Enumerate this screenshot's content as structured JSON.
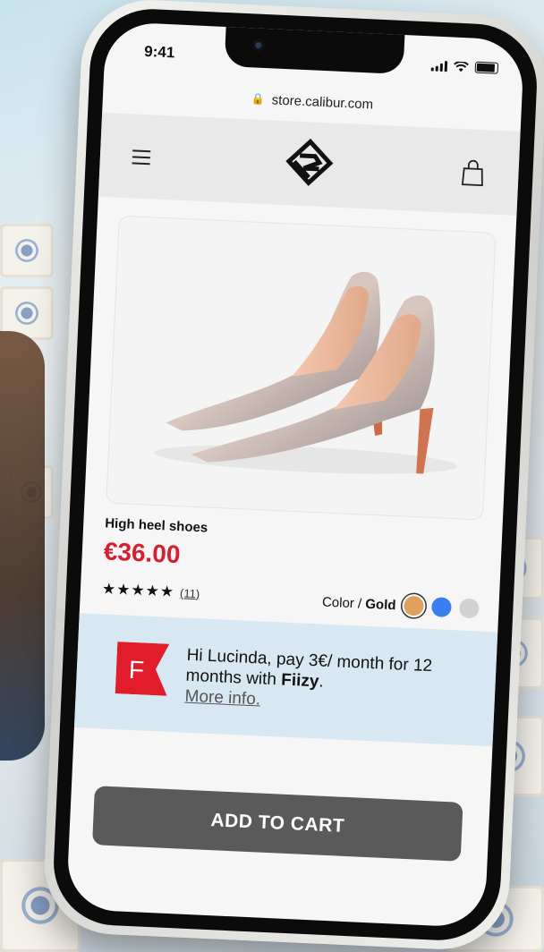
{
  "status_bar": {
    "time": "9:41"
  },
  "browser": {
    "url": "store.calibur.com"
  },
  "header": {
    "menu_icon": "hamburger-menu-icon",
    "logo_icon": "calibur-logo",
    "cart_icon": "shopping-bag-icon"
  },
  "product": {
    "name": "High heel shoes",
    "price": "€36.00",
    "stars": "★★★★★",
    "review_count": "(11)",
    "color_label": "Color / ",
    "color_name": "Gold",
    "swatches": [
      {
        "name": "gold",
        "hex": "#e0a15e",
        "selected": true
      },
      {
        "name": "blue",
        "hex": "#3b7ef0",
        "selected": false
      },
      {
        "name": "grey",
        "hex": "#d2d2d2",
        "selected": false
      }
    ]
  },
  "financing": {
    "logo_letter": "F",
    "message": "Hi Lucinda, pay 3€/ month for 12 months with ",
    "brand": "Fiizy",
    "message_end": ".",
    "more_info": "More info."
  },
  "cta": {
    "add_to_cart": "ADD TO CART"
  },
  "colors": {
    "price_red": "#d81f2e",
    "banner_blue": "#d7e8f2",
    "button_grey": "#5a5a5a",
    "fiizy_red": "#e11d2b"
  }
}
